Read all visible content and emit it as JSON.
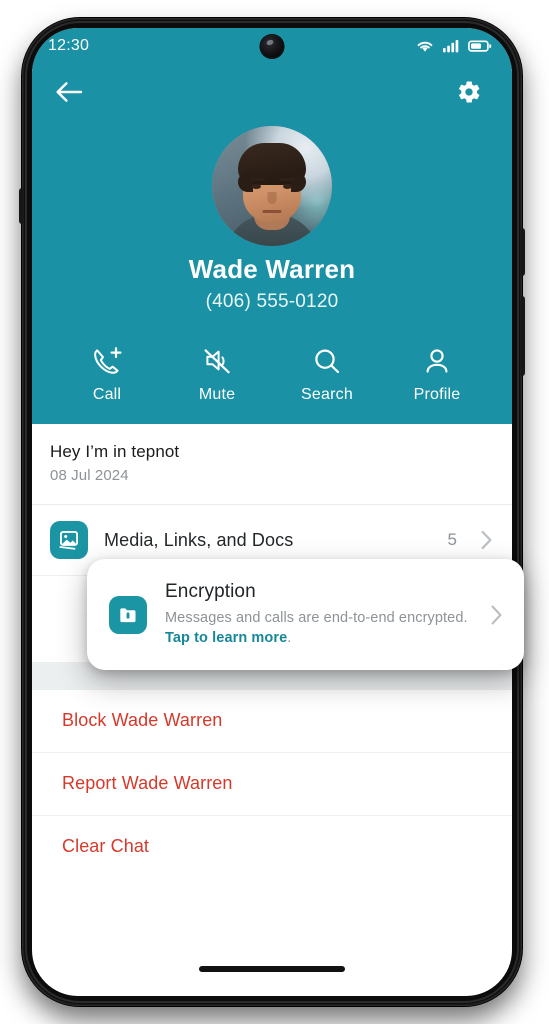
{
  "status_bar": {
    "time": "12:30",
    "icons": [
      "wifi-icon",
      "cellular-signal-icon",
      "battery-icon"
    ]
  },
  "app_bar": {
    "back_icon": "back-arrow-icon",
    "settings_icon": "gear-icon"
  },
  "profile": {
    "name": "Wade Warren",
    "phone": "(406) 555-0120",
    "avatar": "contact-avatar"
  },
  "actions": [
    {
      "label": "Call",
      "icon": "phone-add-icon"
    },
    {
      "label": "Mute",
      "icon": "speaker-mute-icon"
    },
    {
      "label": "Search",
      "icon": "search-icon"
    },
    {
      "label": "Profile",
      "icon": "person-icon"
    }
  ],
  "about": {
    "status_text": "Hey I’m in tepnot",
    "date": "08 Jul 2024"
  },
  "media_row": {
    "label": "Media, Links, and Docs",
    "count": "5",
    "icon": "media-image-icon",
    "chevron": "chevron-right-icon"
  },
  "encryption_card": {
    "title": "Encryption",
    "description": "Messages and calls are end-to-end encrypted.",
    "link_text": "Tap to learn more",
    "description_suffix": ".",
    "icon": "lock-shield-icon",
    "chevron": "chevron-right-icon"
  },
  "danger_actions": [
    {
      "label": "Block Wade Warren"
    },
    {
      "label": "Report Wade Warren"
    },
    {
      "label": "Clear Chat"
    }
  ],
  "colors": {
    "brand_teal": "#1a91a4",
    "danger_red": "#d6392a",
    "link_teal": "#17879a",
    "muted_gray": "#8d9397",
    "section_gap": "#eceff0"
  }
}
